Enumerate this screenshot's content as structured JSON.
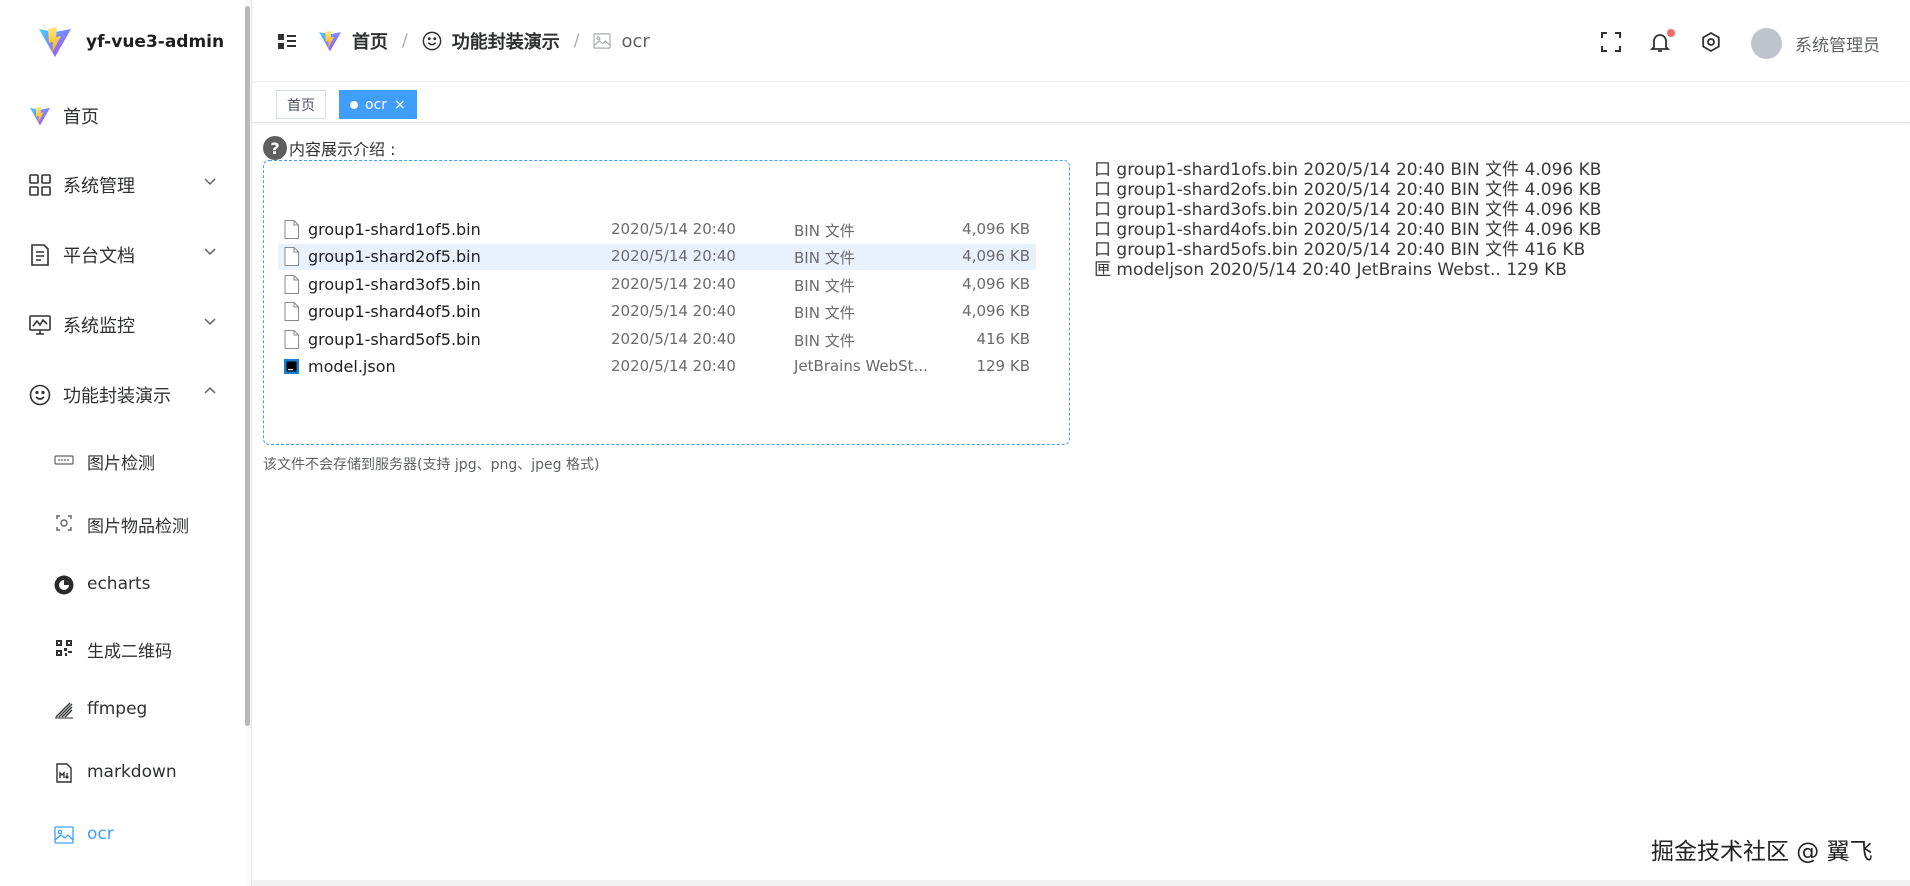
{
  "app": {
    "title": "yf-vue3-admin"
  },
  "sidebar": {
    "items": [
      {
        "label": "首页",
        "icon": "vite-logo-icon"
      },
      {
        "label": "系统管理",
        "icon": "grid-icon"
      },
      {
        "label": "平台文档",
        "icon": "document-icon"
      },
      {
        "label": "系统监控",
        "icon": "monitor-icon"
      },
      {
        "label": "功能封装演示",
        "icon": "smile-icon"
      }
    ],
    "sub_items": [
      {
        "label": "图片检测",
        "icon": "image-detect-icon"
      },
      {
        "label": "图片物品检测",
        "icon": "object-detect-icon"
      },
      {
        "label": "echarts",
        "icon": "echarts-icon"
      },
      {
        "label": "生成二维码",
        "icon": "qrcode-icon"
      },
      {
        "label": "ffmpeg",
        "icon": "ffmpeg-icon"
      },
      {
        "label": "markdown",
        "icon": "markdown-icon"
      },
      {
        "label": "ocr",
        "icon": "picture-icon"
      }
    ]
  },
  "breadcrumb": [
    {
      "label": "首页"
    },
    {
      "label": "功能封装演示"
    },
    {
      "label": "ocr"
    }
  ],
  "header": {
    "username": "系统管理员"
  },
  "tags": [
    {
      "label": "首页"
    },
    {
      "label": "ocr"
    }
  ],
  "tag_close_glyph": "×",
  "main": {
    "intro_label": "内容展示介绍 :",
    "qmark": "?",
    "hint": "该文件不会存储到服务器(支持 jpg、png、jpeg 格式)",
    "files": [
      {
        "name": "group1-shard1of5.bin",
        "date": "2020/5/14 20:40",
        "type": "BIN 文件",
        "size": "4,096 KB"
      },
      {
        "name": "group1-shard2of5.bin",
        "date": "2020/5/14 20:40",
        "type": "BIN 文件",
        "size": "4,096 KB"
      },
      {
        "name": "group1-shard3of5.bin",
        "date": "2020/5/14 20:40",
        "type": "BIN 文件",
        "size": "4,096 KB"
      },
      {
        "name": "group1-shard4of5.bin",
        "date": "2020/5/14 20:40",
        "type": "BIN 文件",
        "size": "4,096 KB"
      },
      {
        "name": "group1-shard5of5.bin",
        "date": "2020/5/14 20:40",
        "type": "BIN 文件",
        "size": "416 KB"
      },
      {
        "name": "model.json",
        "date": "2020/5/14 20:40",
        "type": "JetBrains WebSt...",
        "size": "129 KB"
      }
    ],
    "ocr_output": [
      "口 group1-shard1ofs.bin 2020/5/14 20:40 BIN 文件 4.096 KB",
      "口 group1-shard2ofs.bin 2020/5/14 20:40 BIN 文件 4.096 KB",
      "口 group1-shard3ofs.bin 2020/5/14 20:40 BIN 文件 4.096 KB",
      "口 group1-shard4ofs.bin 2020/5/14 20:40 BIN 文件 4.096 KB",
      "口 group1-shard5ofs.bin 2020/5/14 20:40 BIN 文件 416 KB",
      "匣 modeljson 2020/5/14 20:40 JetBrains Webst.. 129 KB"
    ]
  },
  "watermark": "掘金技术社区 @ 翼飞",
  "colors": {
    "accent": "#409eff",
    "badge": "#f56c6c",
    "selected_row": "#e8f1fc"
  }
}
